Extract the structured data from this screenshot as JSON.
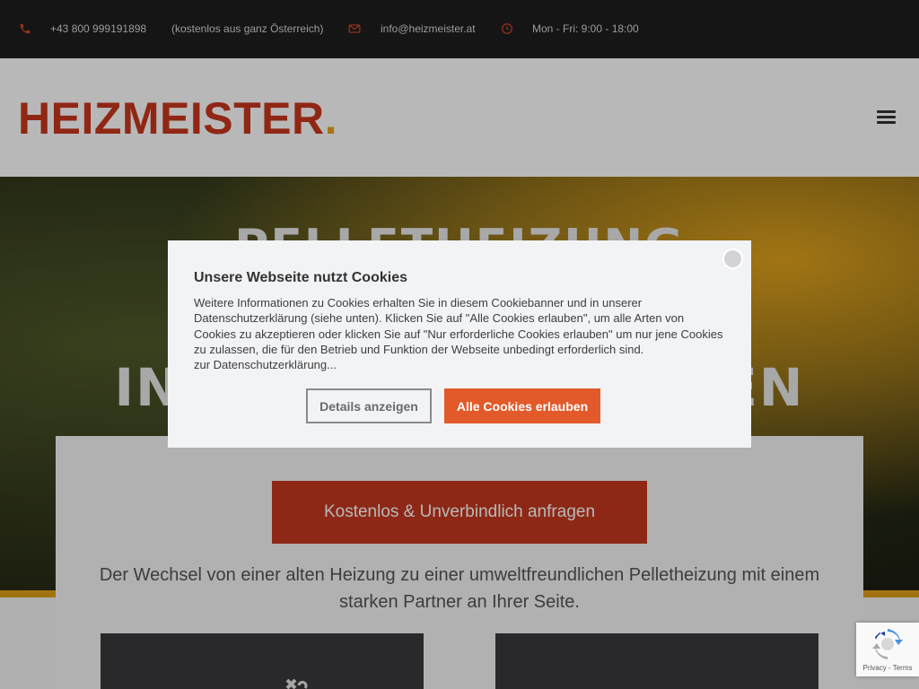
{
  "topbar": {
    "phone": "+43 800 999191898",
    "phone_note": "(kostenlos aus ganz Österreich)",
    "email": "info@heizmeister.at",
    "hours": "Mon - Fri: 9:00 - 18:00"
  },
  "header": {
    "logo_text": "HEIZMEISTER",
    "logo_dot": ".",
    "menu_icon": "hamburger-icon"
  },
  "hero": {
    "title_line1": "PELLETHEIZUNG",
    "title_line2": "VOM HEIZMEISTER INSTALLIEREN LASSEN"
  },
  "card": {
    "cta_label": "Kostenlos & Unverbindlich anfragen",
    "text": "Der Wechsel von einer alten Heizung zu einer umweltfreundlichen Pelletheizung mit einem starken Partner an Ihrer Seite."
  },
  "cookie": {
    "title": "Unsere Webseite nutzt Cookies",
    "text": "Weitere Informationen zu Cookies erhalten Sie in diesem Cookiebanner und in unserer Datenschutzerklärung (siehe unten). Klicken Sie auf \"Alle Cookies erlauben\", um alle Arten von Cookies zu akzeptieren oder klicken Sie auf \"Nur erforderliche Cookies erlauben\" um nur jene Cookies zu zulassen, die für den Betrieb und Funktion der Webseite unbedingt erforderlich sind.",
    "privacy_link": "zur Datenschutzerklärung...",
    "details_label": "Details anzeigen",
    "allow_label": "Alle Cookies erlauben"
  },
  "recaptcha": {
    "privacy": "Privacy",
    "separator": " - ",
    "terms": "Terms"
  },
  "colors": {
    "brand_red": "#c8361c",
    "brand_accent": "#e7a515",
    "cta": "#c4381f",
    "allow_button": "#e25a2a",
    "topbar_bg": "#1e1e1e"
  }
}
